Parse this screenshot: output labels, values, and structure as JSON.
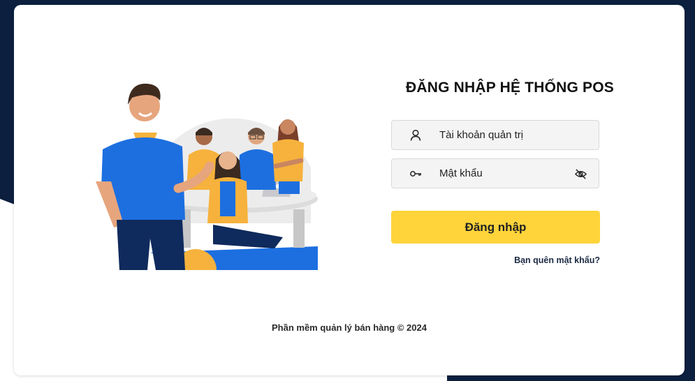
{
  "login": {
    "title": "ĐĂNG NHẬP HỆ THỐNG POS",
    "username_placeholder": "Tài khoản quản trị",
    "password_placeholder": "Mật khẩu",
    "submit_label": "Đăng nhập",
    "forgot_label": "Bạn quên mật khẩu?"
  },
  "footer": {
    "text": "Phần mềm quản lý bán hàng © 2024"
  },
  "icons": {
    "username": "user-icon",
    "password": "key-icon",
    "toggle_password": "eye-off-icon"
  },
  "colors": {
    "background_navy": "#0c1f3f",
    "button_yellow": "#ffd43b",
    "illustration_blue": "#1d6fe0",
    "illustration_orange": "#f6b23c"
  }
}
